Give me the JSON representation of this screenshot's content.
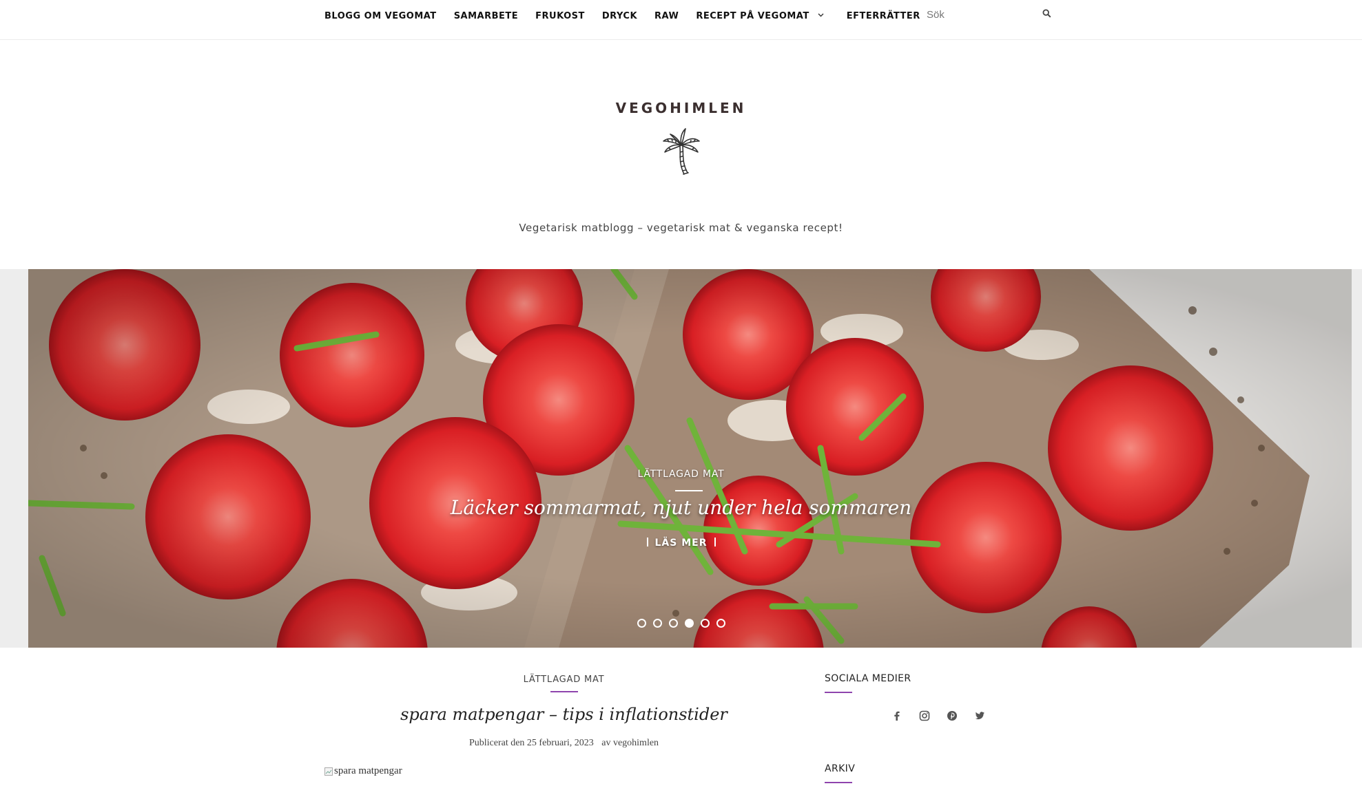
{
  "nav": {
    "items": [
      {
        "label": "BLOGG OM VEGOMAT"
      },
      {
        "label": "SAMARBETE"
      },
      {
        "label": "FRUKOST"
      },
      {
        "label": "DRYCK"
      },
      {
        "label": "RAW"
      },
      {
        "label": "RECEPT PÅ VEGOMAT"
      },
      {
        "label": "EFTERRÄTTER"
      }
    ],
    "search_placeholder": "Sök",
    "search_icon": "search-icon",
    "dropdown_icon": "chevron-down-icon"
  },
  "site": {
    "name": "VEGOHIMLEN",
    "logo_icon": "palm-tree-icon",
    "tagline": "Vegetarisk matblogg – vegetarisk mat & veganska recept!"
  },
  "hero": {
    "category": "LÄTTLAGAD MAT",
    "title": "Läcker sommarmat, njut under hela sommaren",
    "read_more": "LÄS MER",
    "slide_count": 6,
    "active_slide": 4
  },
  "post": {
    "category": "LÄTTLAGAD MAT",
    "title": "spara matpengar – tips i inflationstider",
    "published": "Publicerat den 25 februari, 2023",
    "author": "av vegohimlen",
    "image_alt": "spara matpengar"
  },
  "sidebar": {
    "social_title": "SOCIALA MEDIER",
    "social_icons": [
      "facebook-icon",
      "instagram-icon",
      "pinterest-icon",
      "twitter-icon"
    ],
    "archive_title": "ARKIV"
  },
  "colors": {
    "accent": "#8e44ad",
    "text": "#222222",
    "logo": "#3b2f2f"
  }
}
